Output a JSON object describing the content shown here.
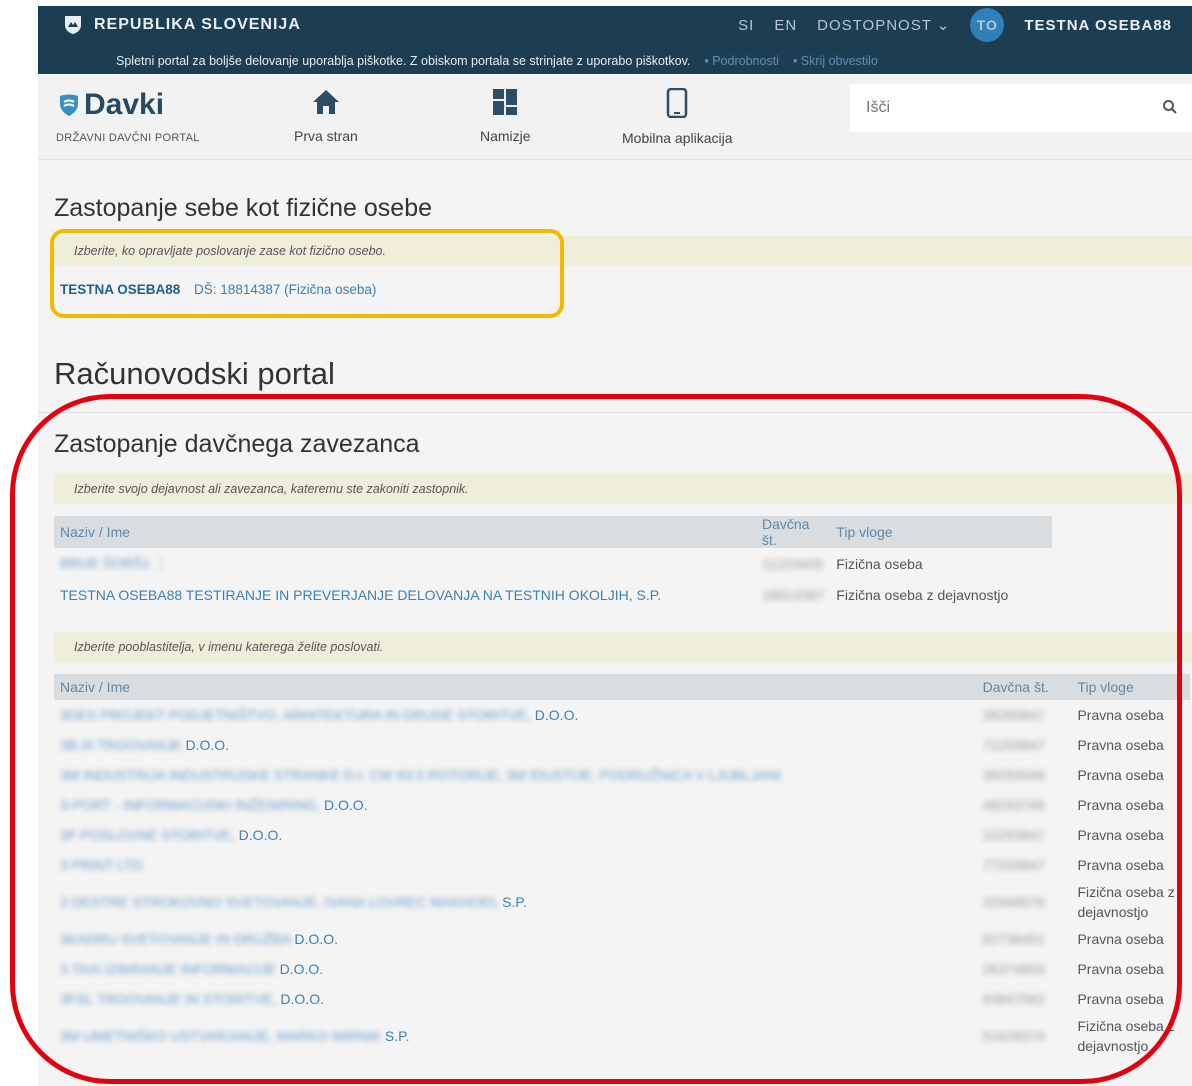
{
  "topbar": {
    "brand": "REPUBLIKA SLOVENIJA",
    "lang_si": "SI",
    "lang_en": "EN",
    "accessibility": "DOSTOPNOST ⌄",
    "avatar_initials": "TO",
    "user_name": "TESTNA OSEBA88",
    "cookie_text": "Spletni portal za boljše delovanje uporablja piškotke. Z obiskom portala se strinjate z uporabo piškotkov.",
    "cookie_more": "• Podrobnosti",
    "cookie_hide": "• Skrij obvestilo"
  },
  "header": {
    "logo_word": "Davki",
    "logo_sub": "DRŽAVNI DAVČNI PORTAL",
    "nav": [
      {
        "label": "Prva stran",
        "icon": "home-icon"
      },
      {
        "label": "Namizje",
        "icon": "dashboard-icon"
      },
      {
        "label": "Mobilna aplikacija",
        "icon": "mobile-icon"
      }
    ],
    "search_placeholder": "Išči"
  },
  "self_section": {
    "title": "Zastopanje sebe kot fizične osebe",
    "hint": "Izberite, ko opravljate poslovanje zase kot fizično osebo.",
    "name": "TESTNA OSEBA88",
    "tax": "DŠ: 18814387 (Fizična oseba)"
  },
  "portal_title": "Računovodski portal",
  "representation": {
    "title": "Zastopanje davčnega zavezanca",
    "hint": "Izberite svojo dejavnost ali zavezanca, kateremu ste zakoniti zastopnik.",
    "col_name": "Naziv / Ime",
    "col_tax": "Davčna št.",
    "col_role": "Tip vloge",
    "rows": [
      {
        "name_blur": "BRUE ŠORŠ1 ⋮",
        "name_clear": "",
        "tax": "11223455",
        "role": "Fizična oseba"
      },
      {
        "name_blur": "",
        "name_clear": "TESTNA OSEBA88 TESTIRANJE IN PREVERJANJE DELOVANJA NA TESTNIH OKOLJIH, S.P.",
        "tax": "18814387",
        "role": "Fizična oseba z dejavnostjo"
      }
    ]
  },
  "authorizers": {
    "hint": "Izberite pooblastitelja, v imenu katerega želite poslovati.",
    "col_name": "Naziv / Ime",
    "col_tax": "Davčna št.",
    "col_role": "Tip vloge",
    "rows": [
      {
        "name_blur": "3DES PROJEKT PODJETNIŠTVO, ARHITEKTURA IN DRUGE STORITVE,",
        "name_clear": " D.O.O.",
        "tax": "36265847",
        "role": "Pravna oseba",
        "tall": false
      },
      {
        "name_blur": "3B-III TRGOVANJE",
        "name_clear": " D.O.O.",
        "tax": "71293847",
        "role": "Pravna oseba",
        "tall": false
      },
      {
        "name_blur": "3M INDUSTRIJA INDUSTRIJSKE STRANKE D.I. CW 63.5 ROTORIJE, 3M IDUSTIJE, PODRUŽNICA V LJUBLJANI",
        "name_clear": "",
        "tax": "38293048",
        "role": "Pravna oseba",
        "tall": false
      },
      {
        "name_blur": "3-PORT - INFORMACIJSKI INŽENIRING,",
        "name_clear": " D.O.O.",
        "tax": "48293746",
        "role": "Pravna oseba",
        "tall": false
      },
      {
        "name_blur": "3F POSLOVNE STORITVE,",
        "name_clear": " D.O.O.",
        "tax": "15293847",
        "role": "Pravna oseba",
        "tall": false
      },
      {
        "name_blur": "3 PRINT LTD",
        "name_clear": "",
        "tax": "77293847",
        "role": "Pravna oseba",
        "tall": false
      },
      {
        "name_blur": "3 DESTRE STROKOVNO SVETOVANJE, IVANA LOVREC MAKHOEL",
        "name_clear": " S.P.",
        "tax": "32948576",
        "role": "Fizična oseba z dejavnostjo",
        "tall": true
      },
      {
        "name_blur": "3KADRU SVETOVANJE IN DRUŽBA",
        "name_clear": " D.O.O.",
        "tax": "82736451",
        "role": "Pravna oseba",
        "tall": false
      },
      {
        "name_blur": "3 TAXI IZBIRANJE INFORMACIJE",
        "name_clear": " D.O.O.",
        "tax": "26374859",
        "role": "Pravna oseba",
        "tall": false
      },
      {
        "name_blur": "3FSL TRGOVANJE IN STORITVE,",
        "name_clear": " D.O.O.",
        "tax": "93847562",
        "role": "Pravna oseba",
        "tall": false
      },
      {
        "name_blur": "3M UMETNIŠKO USTVARJANJE, MARKO MIRNIK",
        "name_clear": " S.P.",
        "tax": "51628374",
        "role": "Fizična oseba z dejavnostjo",
        "tall": true
      }
    ]
  }
}
